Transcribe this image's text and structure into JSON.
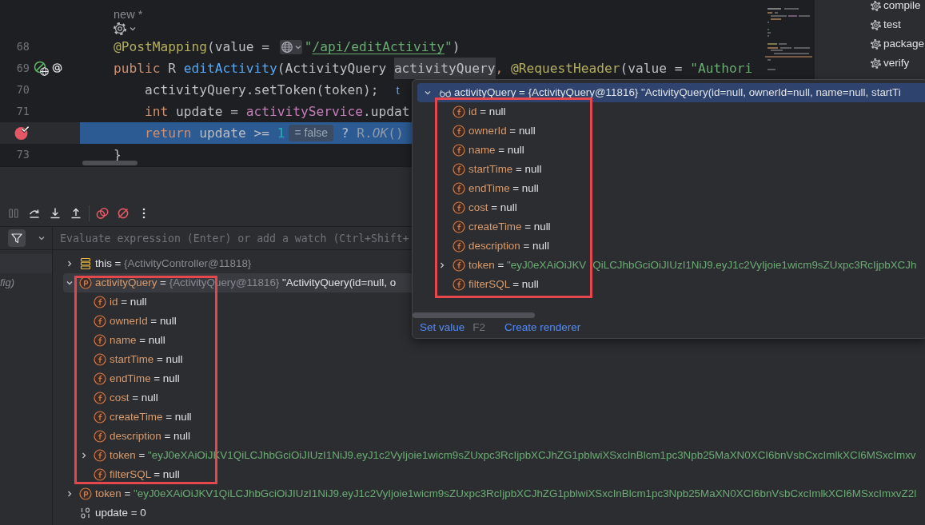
{
  "editor": {
    "lines": [
      {
        "kind": "inlay",
        "segments": [
          {
            "text": "new *",
            "kind": "hint"
          }
        ]
      },
      {
        "kind": "inlay",
        "segments": [
          {
            "kind": "menu"
          }
        ]
      },
      {
        "kind": "code",
        "number": "68",
        "breakpoint": false,
        "current": false,
        "segments": [
          {
            "text": "@PostMapping",
            "kind": "annotation"
          },
          {
            "text": "(value = ",
            "kind": "text"
          },
          {
            "kind": "picker"
          },
          {
            "text": "\"",
            "kind": "string"
          },
          {
            "text": "/api/editActivity",
            "kind": "link"
          },
          {
            "text": "\"",
            "kind": "string"
          },
          {
            "text": ")",
            "kind": "text"
          }
        ]
      },
      {
        "kind": "code",
        "number": "69",
        "breakpoint": false,
        "current": false,
        "markers": [
          {
            "kind": "endpoint"
          },
          {
            "kind": "annotation"
          }
        ],
        "segments": [
          {
            "text": "public",
            "kind": "keyword"
          },
          {
            "text": " R ",
            "kind": "text"
          },
          {
            "text": "editActivity",
            "kind": "method"
          },
          {
            "text": "(ActivityQuery ",
            "kind": "text"
          },
          {
            "text": "activityQuery",
            "kind": "usage"
          },
          {
            "text": ",",
            "kind": "keyword"
          },
          {
            "text": " @RequestHeader",
            "kind": "annotation"
          },
          {
            "text": "(value = ",
            "kind": "text"
          },
          {
            "text": "\"Authori",
            "kind": "string"
          }
        ],
        "body": [
          {
            "kind": "code",
            "number": "70",
            "breakpoint": false,
            "current": false,
            "segments": [
              {
                "text": "activityQuery.setToken(token);",
                "kind": "text"
              },
              {
                "text": "t",
                "kind": "inline"
              }
            ]
          },
          {
            "kind": "code",
            "number": "71",
            "breakpoint": false,
            "current": false,
            "segments": [
              {
                "text": "int",
                "kind": "keyword"
              },
              {
                "text": " update = ",
                "kind": "text"
              },
              {
                "text": "activityService",
                "kind": "field"
              },
              {
                "text": ".updat",
                "kind": "text"
              }
            ]
          },
          {
            "kind": "code",
            "breakpoint": true,
            "current": true,
            "segments": [
              {
                "text": "return",
                "kind": "keyword"
              },
              {
                "text": " update >= ",
                "kind": "text"
              },
              {
                "text": "1",
                "kind": "number"
              },
              {
                "text": "= false",
                "kind": "value"
              },
              {
                "text": " ? ",
                "kind": "text"
              },
              {
                "text": "R.*OK*()",
                "kind": "call"
              }
            ]
          }
        ]
      },
      {
        "kind": "code",
        "number": "73",
        "breakpoint": false,
        "current": false,
        "segments": [
          {
            "text": "}",
            "kind": "text"
          }
        ]
      }
    ]
  },
  "maven": {
    "lifecycle": [
      {
        "label": "compile"
      },
      {
        "label": "test"
      },
      {
        "label": "package"
      },
      {
        "label": "verify"
      }
    ]
  },
  "debugger": {
    "toolbar": [
      {
        "kind": "pause",
        "disabled": true
      },
      {
        "kind": "step-over",
        "disabled": false
      },
      {
        "kind": "step-into",
        "disabled": false
      },
      {
        "kind": "step-out",
        "disabled": false
      },
      {
        "kind": "separator"
      },
      {
        "kind": "view-breakpoints",
        "disabled": false
      },
      {
        "kind": "mute-breakpoints",
        "disabled": false
      },
      {
        "kind": "more",
        "disabled": false
      }
    ],
    "frames": {
      "filter": {
        "on": true
      },
      "items": [
        {
          "selected": true
        },
        {
          "label": "fig)",
          "selected": false
        }
      ]
    },
    "evaluate": {
      "placeholder": "Evaluate expression (Enter) or add a watch (Ctrl+Shift+"
    },
    "variables": [
      {
        "kind": "object",
        "expanded": false,
        "selected": false,
        "segments": [
          {
            "text": "this = ",
            "kind": "text"
          },
          {
            "text": "{ActivityController@11818}",
            "kind": "reference"
          }
        ]
      },
      {
        "kind": "parameter",
        "expanded": true,
        "selected": true,
        "boxed": true,
        "segments": [
          {
            "text": "activityQuery",
            "kind": "name"
          },
          {
            "text": " = ",
            "kind": "text"
          },
          {
            "text": "{ActivityQuery@11816}",
            "kind": "reference"
          },
          {
            "text": " \"ActivityQuery(id=null, o",
            "kind": "text"
          }
        ],
        "children": [
          {
            "kind": "field",
            "selected": false,
            "segments": [
              {
                "text": "id",
                "kind": "name"
              },
              {
                "text": " = null",
                "kind": "text"
              }
            ]
          },
          {
            "kind": "field",
            "selected": false,
            "segments": [
              {
                "text": "ownerId",
                "kind": "name"
              },
              {
                "text": " = null",
                "kind": "text"
              }
            ]
          },
          {
            "kind": "field",
            "selected": false,
            "segments": [
              {
                "text": "name",
                "kind": "name"
              },
              {
                "text": " = null",
                "kind": "text"
              }
            ]
          },
          {
            "kind": "field",
            "selected": false,
            "segments": [
              {
                "text": "startTime",
                "kind": "name"
              },
              {
                "text": " = null",
                "kind": "text"
              }
            ]
          },
          {
            "kind": "field",
            "selected": false,
            "segments": [
              {
                "text": "endTime",
                "kind": "name"
              },
              {
                "text": " = null",
                "kind": "text"
              }
            ]
          },
          {
            "kind": "field",
            "selected": false,
            "segments": [
              {
                "text": "cost",
                "kind": "name"
              },
              {
                "text": " = null",
                "kind": "text"
              }
            ]
          },
          {
            "kind": "field",
            "selected": false,
            "segments": [
              {
                "text": "createTime",
                "kind": "name"
              },
              {
                "text": " = null",
                "kind": "text"
              }
            ]
          },
          {
            "kind": "field",
            "selected": false,
            "segments": [
              {
                "text": "description",
                "kind": "name"
              },
              {
                "text": " = null",
                "kind": "text"
              }
            ]
          },
          {
            "kind": "field",
            "expanded": false,
            "selected": false,
            "segments": [
              {
                "text": "token",
                "kind": "name"
              },
              {
                "text": " = ",
                "kind": "text"
              },
              {
                "text": "\"eyJ0eXAiOiJKV1QiLCJhbGciOiJIUzI1NiJ9.eyJ1c2VyIjoie1wicm9sZUxpc3RcIjpbXCJhZG1pblwiXSxcInBlcm1pc3Npb25MaXN0XCI6bnVsbCxcImlkXCI6MSxcImxv",
                "kind": "string"
              }
            ]
          },
          {
            "kind": "field",
            "selected": false,
            "segments": [
              {
                "text": "filterSQL",
                "kind": "name"
              },
              {
                "text": " = null",
                "kind": "text"
              }
            ]
          }
        ]
      },
      {
        "kind": "parameter",
        "expanded": false,
        "selected": false,
        "segments": [
          {
            "text": "token",
            "kind": "name"
          },
          {
            "text": " = ",
            "kind": "text"
          },
          {
            "text": "\"eyJ0eXAiOiJKV1QiLCJhbGciOiJIUzI1NiJ9.eyJ1c2VyIjoie1wicm9sZUxpc3RcIjpbXCJhZG1pblwiXSxcInBlcm1pc3Npb25MaXN0XCI6bnVsbCxcImlkXCI6MSxcImxvZ2l",
            "kind": "string"
          }
        ]
      },
      {
        "kind": "primitive",
        "selected": false,
        "segments": [
          {
            "text": "update = 0",
            "kind": "text"
          }
        ]
      }
    ]
  },
  "popup": {
    "boxed": true,
    "header": {
      "kind": "watch",
      "expanded": true,
      "selected": true,
      "segments": [
        {
          "text": "activityQuery = {ActivityQuery@11816} \"ActivityQuery(id=null, ownerId=null, name=null, startTi",
          "kind": "text"
        }
      ]
    },
    "fields": [
      {
        "kind": "field",
        "selected": false,
        "segments": [
          {
            "text": "id",
            "kind": "name"
          },
          {
            "text": " = null",
            "kind": "text"
          }
        ]
      },
      {
        "kind": "field",
        "selected": false,
        "segments": [
          {
            "text": "ownerId",
            "kind": "name"
          },
          {
            "text": " = null",
            "kind": "text"
          }
        ]
      },
      {
        "kind": "field",
        "selected": false,
        "segments": [
          {
            "text": "name",
            "kind": "name"
          },
          {
            "text": " = null",
            "kind": "text"
          }
        ]
      },
      {
        "kind": "field",
        "selected": false,
        "segments": [
          {
            "text": "startTime",
            "kind": "name"
          },
          {
            "text": " = null",
            "kind": "text"
          }
        ]
      },
      {
        "kind": "field",
        "selected": false,
        "segments": [
          {
            "text": "endTime",
            "kind": "name"
          },
          {
            "text": " = null",
            "kind": "text"
          }
        ]
      },
      {
        "kind": "field",
        "selected": false,
        "segments": [
          {
            "text": "cost",
            "kind": "name"
          },
          {
            "text": " = null",
            "kind": "text"
          }
        ]
      },
      {
        "kind": "field",
        "selected": false,
        "segments": [
          {
            "text": "createTime",
            "kind": "name"
          },
          {
            "text": " = null",
            "kind": "text"
          }
        ]
      },
      {
        "kind": "field",
        "selected": false,
        "segments": [
          {
            "text": "description",
            "kind": "name"
          },
          {
            "text": " = null",
            "kind": "text"
          }
        ]
      },
      {
        "kind": "field",
        "expanded": false,
        "selected": false,
        "segments": [
          {
            "text": "token",
            "kind": "name"
          },
          {
            "text": " = ",
            "kind": "text"
          },
          {
            "text": "\"eyJ0eXAiOiJKV",
            "kind": "string"
          },
          {
            "kind": "covered"
          },
          {
            "text": "QiLCJhbGciOiJIUzI1NiJ9.eyJ1c2VyIjoie1wicm9sZUxpc3RcIjpbXCJh",
            "kind": "string"
          }
        ]
      },
      {
        "kind": "field",
        "selected": false,
        "segments": [
          {
            "text": "filterSQL",
            "kind": "name"
          },
          {
            "text": " = null",
            "kind": "text"
          }
        ]
      }
    ],
    "actions": [
      {
        "label": "Set value",
        "shortcut": "F2"
      },
      {
        "label": "Create renderer"
      }
    ]
  }
}
